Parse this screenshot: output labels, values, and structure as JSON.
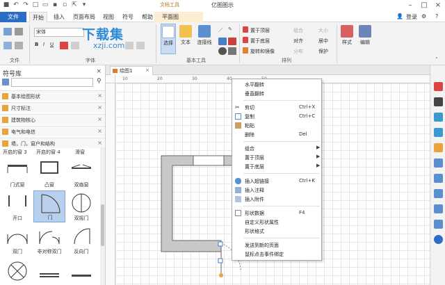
{
  "app": {
    "title": "亿图图示",
    "context_group": "文档工具"
  },
  "tabs": [
    "文件",
    "开始",
    "插入",
    "页面布局",
    "视图",
    "符号",
    "帮助",
    "平面图"
  ],
  "title_right": {
    "login": "登录"
  },
  "ribbon": {
    "font_name": "宋体",
    "groups": [
      "文件",
      "字体",
      "基本工具",
      "排列"
    ],
    "basic_tools": [
      "选择",
      "文本",
      "连接线"
    ],
    "arrange_items": [
      "置于顶层",
      "置于底层",
      "旋转和镜像",
      "组合",
      "对齐",
      "分布",
      "大小",
      "居中",
      "保护"
    ],
    "style_label": "样式",
    "edit_label": "编辑"
  },
  "watermark": {
    "big": "下载集",
    "small": "xzji.com"
  },
  "library": {
    "title": "符号库",
    "categories": [
      "基本绘图形状",
      "尺寸标注",
      "建筑物核心",
      "电气和电信",
      "墙，门，窗户和结构"
    ],
    "col_headers": [
      "开启的窗 3",
      "开启的窗 4",
      "滑窗"
    ],
    "shapes": [
      "门式窗",
      "凸窗",
      "双扇窗",
      "开口",
      "门",
      "双摇门",
      "双门",
      "非对称双门",
      "反向门"
    ]
  },
  "document": {
    "tab_name": "绘图1",
    "ruler_ticks": [
      "10",
      "20",
      "30",
      "40",
      "50"
    ]
  },
  "context_menu": {
    "items": [
      {
        "label": "水平翻转",
        "shortcut": "",
        "submenu": false,
        "icon": false
      },
      {
        "label": "垂直翻转",
        "shortcut": "",
        "submenu": false,
        "icon": false
      },
      {
        "label": "剪切",
        "shortcut": "Ctrl+X",
        "submenu": false,
        "icon": true
      },
      {
        "label": "复制",
        "shortcut": "Ctrl+C",
        "submenu": false,
        "icon": true
      },
      {
        "label": "粘贴",
        "shortcut": "",
        "submenu": false,
        "icon": true
      },
      {
        "label": "删除",
        "shortcut": "Del",
        "submenu": false,
        "icon": false
      },
      {
        "label": "组合",
        "shortcut": "",
        "submenu": true,
        "icon": false
      },
      {
        "label": "置于顶层",
        "shortcut": "",
        "submenu": true,
        "icon": false
      },
      {
        "label": "置于底层",
        "shortcut": "",
        "submenu": true,
        "icon": false
      },
      {
        "label": "插入超链接",
        "shortcut": "Ctrl+K",
        "submenu": false,
        "icon": true
      },
      {
        "label": "插入注释",
        "shortcut": "",
        "submenu": false,
        "icon": true
      },
      {
        "label": "插入附件",
        "shortcut": "",
        "submenu": false,
        "icon": true
      },
      {
        "label": "形状数据",
        "shortcut": "F4",
        "submenu": false,
        "icon": true
      },
      {
        "label": "自定义形状属性",
        "shortcut": "",
        "submenu": false,
        "icon": false
      },
      {
        "label": "形状格式",
        "shortcut": "",
        "submenu": false,
        "icon": false
      },
      {
        "label": "发送到新的页面",
        "shortcut": "",
        "submenu": false,
        "icon": false
      },
      {
        "label": "鼠标点击事件绑定",
        "shortcut": "",
        "submenu": false,
        "icon": false
      }
    ]
  },
  "colors": {
    "accent": "#2b6cc4",
    "door_fill": "#b9d0ec",
    "wall": "#c8c8c8"
  }
}
